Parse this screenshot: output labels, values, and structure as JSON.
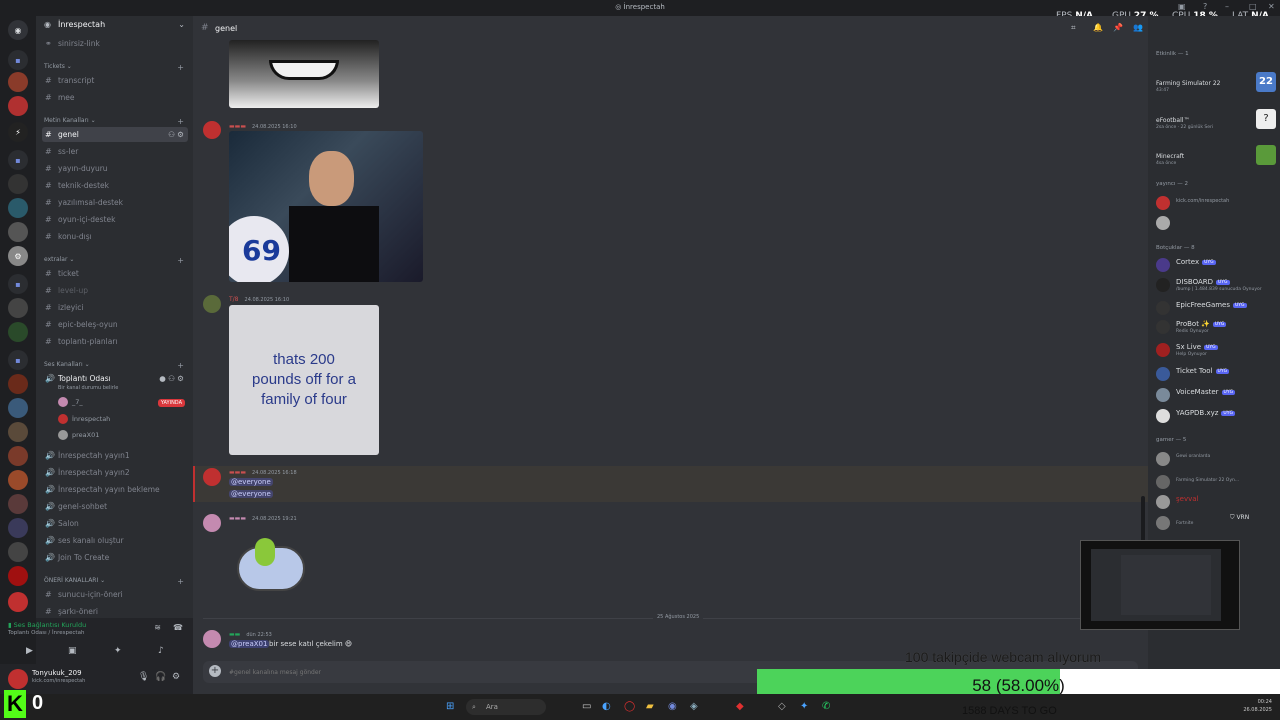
{
  "window": {
    "title": "İnrespectah"
  },
  "overlay": {
    "fps_label": "FPS",
    "fps_value": "N/A",
    "gpu_label": "GPU",
    "gpu_value": "27 %",
    "cpu_label": "CPU",
    "cpu_value": "18 %",
    "lat_label": "LAT",
    "lat_value": "N/A"
  },
  "server": {
    "name": "İnrespectah"
  },
  "channels": {
    "top": [
      "sinirsiz-link"
    ],
    "tickets_cat": "Tickets",
    "tickets": [
      "transcript",
      "mee"
    ],
    "metin_cat": "Metin Kanalları",
    "metin": [
      "genel",
      "ss-ler",
      "yayın-duyuru",
      "teknik-destek",
      "yazılımsal-destek",
      "oyun-içi-destek",
      "konu-dışı"
    ],
    "ekstra_cat": "extralar",
    "ekstra": [
      "ticket",
      "level-up",
      "izleyici",
      "epic-beleş-oyun",
      "toplantı-planları"
    ],
    "ses_cat": "Ses Kanalları",
    "voice_active": "Toplantı Odası",
    "voice_active_sub": "Bir kanal durumu belirle",
    "voice_users": [
      "_7_",
      "İnrespectah",
      "preaX01"
    ],
    "live_badge": "YAYINDA",
    "voice": [
      "İnrespectah yayın1",
      "İnrespectah yayın2",
      "İnrespectah yayın bekleme",
      "genel-sohbet",
      "Salon",
      "ses kanalı oluştur",
      "Join To Create"
    ],
    "oneri_cat": "ÖNERİ KANALLARI",
    "oneri": [
      "sunucu-için-öneri",
      "şarkı-öneri"
    ]
  },
  "voicebar": {
    "status": "Ses Bağlantısı Kuruldu",
    "location": "Toplantı Odası / İnrespectah"
  },
  "user": {
    "name": "Tonyukuk_209",
    "status": "kick.com/inrespectah"
  },
  "chat": {
    "channel": "genel",
    "messages": [
      {
        "time": "24.08.2025 16:10"
      },
      {
        "author": "T/8",
        "time": "24.08.2025 16:10",
        "image_text": "thats 200 pounds off for a family of four"
      },
      {
        "time": "24.08.2025 16:18",
        "mentions": [
          "@everyone",
          "@everyone"
        ]
      },
      {
        "time": "24.08.2025 19:21"
      }
    ],
    "date_divider": "25 Ağustos 2025",
    "last_message": {
      "author_tag": "dün 22:53",
      "mention": "@preaX01",
      "text": "bir sese katıl çekelim"
    },
    "composer_placeholder": "#genel kanalına mesaj gönder"
  },
  "members": {
    "activity_cat": "Etkinlik — 1",
    "activities": [
      {
        "name": "Farming Simulator 22",
        "sub": "43:47",
        "icon_text": "22"
      },
      {
        "name": "eFootball™",
        "sub": "2sa önce · 22 günlük Seri"
      },
      {
        "name": "Minecraft",
        "sub": "4sa önce"
      }
    ],
    "streamer_cat": "yayıncı — 2",
    "streamer_sub": "kick.com/inrespectah",
    "bots_cat": "Botçuklar — 8",
    "bot_badge": "UYG",
    "bots": [
      {
        "name": "Cortex",
        "sub": ""
      },
      {
        "name": "DISBOARD",
        "sub": "/bump | 1.484.839 sunucuda Oynuyor"
      },
      {
        "name": "EpicFreeGames",
        "sub": ""
      },
      {
        "name": "ProBot ✨",
        "sub": "Redis Oynuyor"
      },
      {
        "name": "Sx Live",
        "sub": "Help Oynuyor"
      },
      {
        "name": "Ticket Tool",
        "sub": ""
      },
      {
        "name": "VoiceMaster",
        "sub": ""
      },
      {
        "name": "YAGPDB.xyz",
        "sub": ""
      }
    ],
    "gamer_cat": "gamer — 5",
    "gamers": [
      {
        "name": "",
        "sub": "Gewi oranlarda"
      },
      {
        "name": "",
        "sub": "Farming Simulator 22 Oyn..."
      },
      {
        "name": "şevval",
        "sub": ""
      },
      {
        "name": "",
        "sub": "Fortnite",
        "tag": "VRN"
      }
    ]
  },
  "stream": {
    "ticker": "100 takipçide webcam alıyorum",
    "progress_label": "58 (58.00%)",
    "progress_fraction": 0.58,
    "days": "1588 DAYS TO GO",
    "kick_count": "0"
  },
  "taskbar": {
    "search_placeholder": "Ara",
    "time": "00:24",
    "date": "26.08.2025"
  },
  "colors": {
    "accent": "#5865f2",
    "progress": "#4cd35a",
    "kick": "#53fc18",
    "live": "#da373c"
  }
}
